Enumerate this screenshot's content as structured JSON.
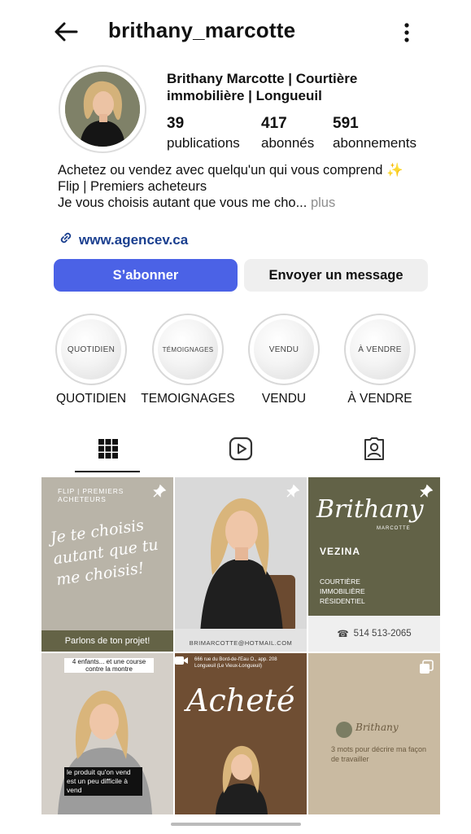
{
  "header": {
    "username": "brithany_marcotte"
  },
  "profile": {
    "display_name": "Brithany Marcotte | Courtière immobilière | Longueuil",
    "stats": [
      {
        "value": "39",
        "label": "publications"
      },
      {
        "value": "417",
        "label": "abonnés"
      },
      {
        "value": "591",
        "label": "abonnements"
      }
    ],
    "bio": {
      "line1": "Achetez ou vendez  avec quelqu'un qui vous comprend ✨",
      "line2": "Flip | Premiers acheteurs",
      "line3": "Je vous choisis autant que vous me cho...",
      "more": "plus"
    },
    "link": "www.agencev.ca"
  },
  "actions": {
    "follow": "S’abonner",
    "message": "Envoyer un message"
  },
  "highlights": [
    {
      "inner": "QUOTIDIEN",
      "label": "QUOTIDIEN"
    },
    {
      "inner": "TÉMOIGNAGES",
      "label": "TEMOIGNAGES"
    },
    {
      "inner": "VENDU",
      "label": "VENDU"
    },
    {
      "inner": "À VENDRE",
      "label": "À VENDRE"
    }
  ],
  "posts": {
    "p1": {
      "top": "FLIP | PREMIERS ACHETEURS",
      "script": "Je te choisis autant que tu me choisis!",
      "footer": "Parlons de ton projet!"
    },
    "p2": {
      "email": "BRIMARCOTTE@HOTMAIL.COM"
    },
    "p3": {
      "script": "Brithany",
      "sub": "MARCOTTE",
      "brand": "VEZINA",
      "l1": "COURTIÈRE",
      "l2": "IMMOBILIÈRE",
      "l3": "RÉSIDENTIEL",
      "phone": "514 513-2065"
    },
    "p4": {
      "cap1": "4 enfants... et une course contre la montre",
      "cap2": "le produit qu'on vend est un peu difficile à vend"
    },
    "p5": {
      "addr": "666 rue du Bord-de-l'Eau O., app. 208 Longueuil (Le Vieux-Longueuil)",
      "script": "Acheté"
    },
    "p6": {
      "sig": "Brithany",
      "text": "3 mots pour décrire ma façon de travailler"
    }
  },
  "colors": {
    "accent": "#4b62e6",
    "olive": "#626247",
    "taupe": "#c8b9a0"
  }
}
